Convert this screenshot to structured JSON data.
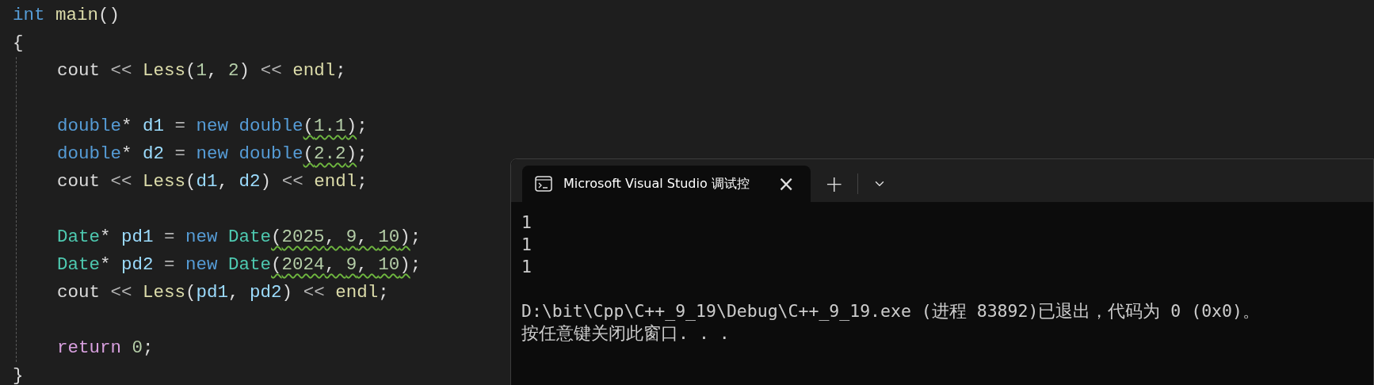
{
  "editor": {
    "signature": [
      {
        "text": "int",
        "kind": "keyword"
      },
      {
        "text": " main",
        "kind": "function"
      },
      {
        "text": "()",
        "kind": "plain"
      }
    ],
    "open_brace": "{",
    "body": [
      {
        "kind": "code",
        "tokens": [
          {
            "text": "cout",
            "kind": "plain"
          },
          {
            "text": " << ",
            "kind": "operator"
          },
          {
            "text": "Less",
            "kind": "function"
          },
          {
            "text": "(",
            "kind": "plain"
          },
          {
            "text": "1",
            "kind": "number"
          },
          {
            "text": ", ",
            "kind": "plain"
          },
          {
            "text": "2",
            "kind": "number"
          },
          {
            "text": ")",
            "kind": "plain"
          },
          {
            "text": " << ",
            "kind": "operator"
          },
          {
            "text": "endl",
            "kind": "function"
          },
          {
            "text": ";",
            "kind": "plain"
          }
        ]
      },
      {
        "kind": "blank"
      },
      {
        "kind": "code",
        "tokens": [
          {
            "text": "double",
            "kind": "keyword"
          },
          {
            "text": "* ",
            "kind": "plain"
          },
          {
            "text": "d1",
            "kind": "variable"
          },
          {
            "text": " = ",
            "kind": "operator"
          },
          {
            "text": "new",
            "kind": "keyword"
          },
          {
            "text": " double",
            "kind": "keyword"
          },
          {
            "text": "(",
            "kind": "plain",
            "squiggle": true
          },
          {
            "text": "1.1",
            "kind": "number",
            "squiggle": true
          },
          {
            "text": ")",
            "kind": "plain",
            "squiggle": true
          },
          {
            "text": ";",
            "kind": "plain"
          }
        ]
      },
      {
        "kind": "code",
        "tokens": [
          {
            "text": "double",
            "kind": "keyword"
          },
          {
            "text": "* ",
            "kind": "plain"
          },
          {
            "text": "d2",
            "kind": "variable"
          },
          {
            "text": " = ",
            "kind": "operator"
          },
          {
            "text": "new",
            "kind": "keyword"
          },
          {
            "text": " double",
            "kind": "keyword"
          },
          {
            "text": "(",
            "kind": "plain",
            "squiggle": true
          },
          {
            "text": "2.2",
            "kind": "number",
            "squiggle": true
          },
          {
            "text": ")",
            "kind": "plain",
            "squiggle": true
          },
          {
            "text": ";",
            "kind": "plain"
          }
        ]
      },
      {
        "kind": "code",
        "tokens": [
          {
            "text": "cout",
            "kind": "plain"
          },
          {
            "text": " << ",
            "kind": "operator"
          },
          {
            "text": "Less",
            "kind": "function"
          },
          {
            "text": "(",
            "kind": "plain"
          },
          {
            "text": "d1",
            "kind": "variable"
          },
          {
            "text": ", ",
            "kind": "plain"
          },
          {
            "text": "d2",
            "kind": "variable"
          },
          {
            "text": ")",
            "kind": "plain"
          },
          {
            "text": " << ",
            "kind": "operator"
          },
          {
            "text": "endl",
            "kind": "function"
          },
          {
            "text": ";",
            "kind": "plain"
          }
        ]
      },
      {
        "kind": "blank"
      },
      {
        "kind": "code",
        "tokens": [
          {
            "text": "Date",
            "kind": "type"
          },
          {
            "text": "* ",
            "kind": "plain"
          },
          {
            "text": "pd1",
            "kind": "variable"
          },
          {
            "text": " = ",
            "kind": "operator"
          },
          {
            "text": "new",
            "kind": "keyword"
          },
          {
            "text": " Date",
            "kind": "type"
          },
          {
            "text": "(",
            "kind": "plain",
            "squiggle": true
          },
          {
            "text": "2025",
            "kind": "number",
            "squiggle": true
          },
          {
            "text": ", ",
            "kind": "plain",
            "squiggle": true
          },
          {
            "text": "9",
            "kind": "number",
            "squiggle": true
          },
          {
            "text": ", ",
            "kind": "plain",
            "squiggle": true
          },
          {
            "text": "10",
            "kind": "number",
            "squiggle": true
          },
          {
            "text": ")",
            "kind": "plain",
            "squiggle": true
          },
          {
            "text": ";",
            "kind": "plain"
          }
        ]
      },
      {
        "kind": "code",
        "tokens": [
          {
            "text": "Date",
            "kind": "type"
          },
          {
            "text": "* ",
            "kind": "plain"
          },
          {
            "text": "pd2",
            "kind": "variable"
          },
          {
            "text": " = ",
            "kind": "operator"
          },
          {
            "text": "new",
            "kind": "keyword"
          },
          {
            "text": " Date",
            "kind": "type"
          },
          {
            "text": "(",
            "kind": "plain",
            "squiggle": true
          },
          {
            "text": "2024",
            "kind": "number",
            "squiggle": true
          },
          {
            "text": ", ",
            "kind": "plain",
            "squiggle": true
          },
          {
            "text": "9",
            "kind": "number",
            "squiggle": true
          },
          {
            "text": ", ",
            "kind": "plain",
            "squiggle": true
          },
          {
            "text": "10",
            "kind": "number",
            "squiggle": true
          },
          {
            "text": ")",
            "kind": "plain",
            "squiggle": true
          },
          {
            "text": ";",
            "kind": "plain"
          }
        ]
      },
      {
        "kind": "code",
        "tokens": [
          {
            "text": "cout",
            "kind": "plain"
          },
          {
            "text": " << ",
            "kind": "operator"
          },
          {
            "text": "Less",
            "kind": "function"
          },
          {
            "text": "(",
            "kind": "plain"
          },
          {
            "text": "pd1",
            "kind": "variable"
          },
          {
            "text": ", ",
            "kind": "plain"
          },
          {
            "text": "pd2",
            "kind": "variable"
          },
          {
            "text": ")",
            "kind": "plain"
          },
          {
            "text": " << ",
            "kind": "operator"
          },
          {
            "text": "endl",
            "kind": "function"
          },
          {
            "text": ";",
            "kind": "plain"
          }
        ]
      },
      {
        "kind": "blank"
      },
      {
        "kind": "code",
        "tokens": [
          {
            "text": "return",
            "kind": "control"
          },
          {
            "text": " 0",
            "kind": "number"
          },
          {
            "text": ";",
            "kind": "plain"
          }
        ]
      }
    ],
    "close_brace": "}"
  },
  "terminal": {
    "tab": {
      "title": "Microsoft Visual Studio 调试控",
      "close": "×",
      "selected": true
    },
    "new_tab": "+",
    "output": [
      "1",
      "1",
      "1"
    ],
    "messages": [
      "D:\\bit\\Cpp\\C++_9_19\\Debug\\C++_9_19.exe (进程 83892)已退出，代码为 0 (0x0)。",
      "按任意键关闭此窗口. . ."
    ]
  }
}
